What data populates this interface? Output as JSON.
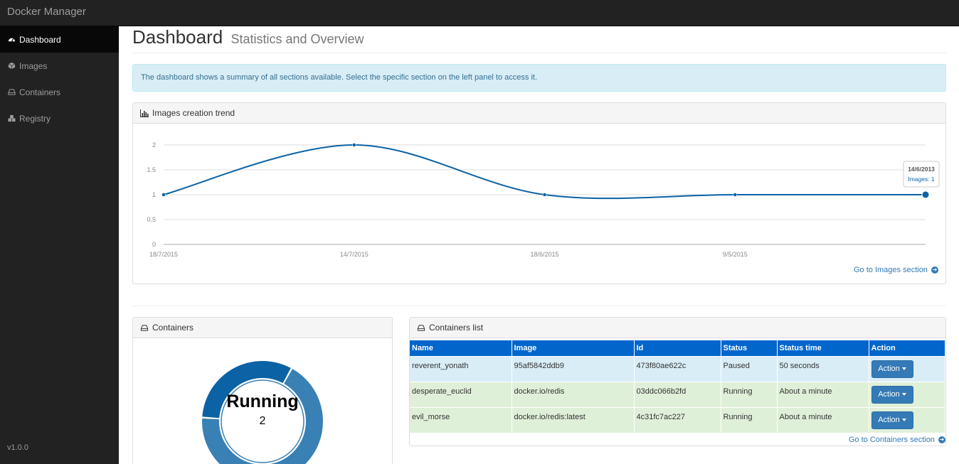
{
  "app": {
    "title": "Docker Manager",
    "version": "v1.0.0"
  },
  "sidebar": {
    "items": [
      {
        "label": "Dashboard",
        "icon": "dashboard-icon",
        "active": true
      },
      {
        "label": "Images",
        "icon": "cube-icon",
        "active": false
      },
      {
        "label": "Containers",
        "icon": "hdd-icon",
        "active": false
      },
      {
        "label": "Registry",
        "icon": "cubes-icon",
        "active": false
      }
    ]
  },
  "header": {
    "title": "Dashboard",
    "subtitle": "Statistics and Overview"
  },
  "alert": {
    "text": "The dashboard shows a summary of all sections available. Select the specific section on the left panel to access it."
  },
  "images_panel": {
    "title": "Images creation trend",
    "link": "Go to Images section",
    "tooltip": {
      "date": "14/6/2013",
      "label": "Images: 1"
    }
  },
  "chart_data": {
    "type": "line",
    "title": "Images creation trend",
    "x": [
      "18/7/2015",
      "14/7/2015",
      "18/6/2015",
      "9/5/2015",
      "14/6/2013"
    ],
    "x_tick_labels": [
      "18/7/2015",
      "14/7/2015",
      "18/6/2015",
      "9/5/2015"
    ],
    "y_ticks": [
      0,
      0.5,
      1,
      1.5,
      2
    ],
    "ylim": [
      0,
      2
    ],
    "series": [
      {
        "name": "Images",
        "values": [
          1,
          2,
          1,
          1,
          1
        ]
      }
    ],
    "grid": true,
    "color": "#0b62a4"
  },
  "containers_panel": {
    "title": "Containers",
    "donut": {
      "label": "Running",
      "value": "2",
      "colors": [
        "#3980b5",
        "#0b62a4"
      ],
      "fractions": [
        0.68,
        0.32
      ]
    }
  },
  "containers_list": {
    "title": "Containers list",
    "link": "Go to Containers section",
    "columns": [
      "Name",
      "Image",
      "Id",
      "Status",
      "Status time",
      "Action"
    ],
    "rows": [
      {
        "name": "reverent_yonath",
        "image": "95af5842ddb9",
        "id": "473f80ae622c",
        "status": "Paused",
        "time": "50 seconds",
        "action": "Action",
        "style": "info"
      },
      {
        "name": "desperate_euclid",
        "image": "docker.io/redis",
        "id": "03ddc066b2fd",
        "status": "Running",
        "time": "About a minute",
        "action": "Action",
        "style": "success"
      },
      {
        "name": "evil_morse",
        "image": "docker.io/redis:latest",
        "id": "4c31fc7ac227",
        "status": "Running",
        "time": "About a minute",
        "action": "Action",
        "style": "success"
      }
    ]
  }
}
